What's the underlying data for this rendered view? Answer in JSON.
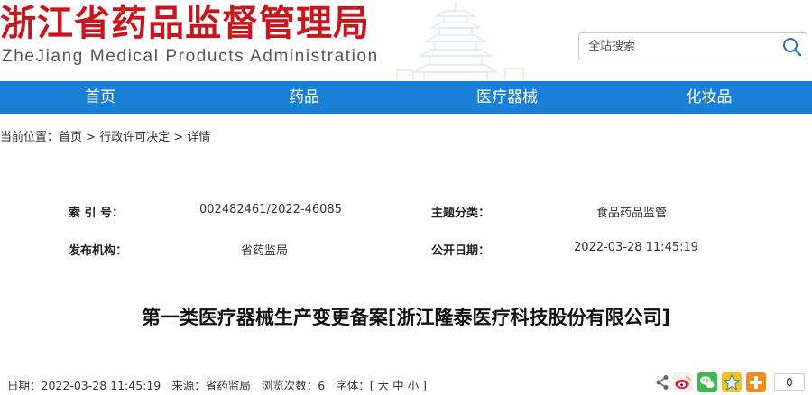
{
  "header": {
    "site_title": "浙江省药品监督管理局",
    "site_subtitle": "ZheJiang Medical Products Administration",
    "search_placeholder": "全站搜索"
  },
  "nav": {
    "items": [
      {
        "label": "首页"
      },
      {
        "label": "药品"
      },
      {
        "label": "医疗器械"
      },
      {
        "label": "化妆品"
      }
    ]
  },
  "breadcrumb": {
    "prefix": "当前位置：",
    "items": [
      "首页",
      "行政许可决定",
      "详情"
    ],
    "separator": " > "
  },
  "meta": {
    "index_label": "索 引 号：",
    "index_value": "002482461/2022-46085",
    "topic_label": "主题分类：",
    "topic_value": "食品药品监管",
    "publisher_label": "发布机构：",
    "publisher_value": "省药监局",
    "date_label": "公开日期：",
    "date_value": "2022-03-28 11:45:19"
  },
  "article": {
    "title": "第一类医疗器械生产变更备案[浙江隆泰医疗科技股份有限公司]"
  },
  "info": {
    "date": "日期：2022-03-28 11:45:19",
    "source": "来源：省药监局",
    "views": "浏览次数：6",
    "font_prefix": "字体：[",
    "font_large": "大",
    "font_medium": "中",
    "font_small": "小",
    "font_suffix": "]"
  },
  "share": {
    "count": "0",
    "icons": [
      "share-icon",
      "weibo-icon",
      "wechat-icon",
      "qzone-icon",
      "more-icon"
    ]
  },
  "colors": {
    "brand_red": "#c8161e",
    "nav_blue": "#1a7fd6"
  }
}
